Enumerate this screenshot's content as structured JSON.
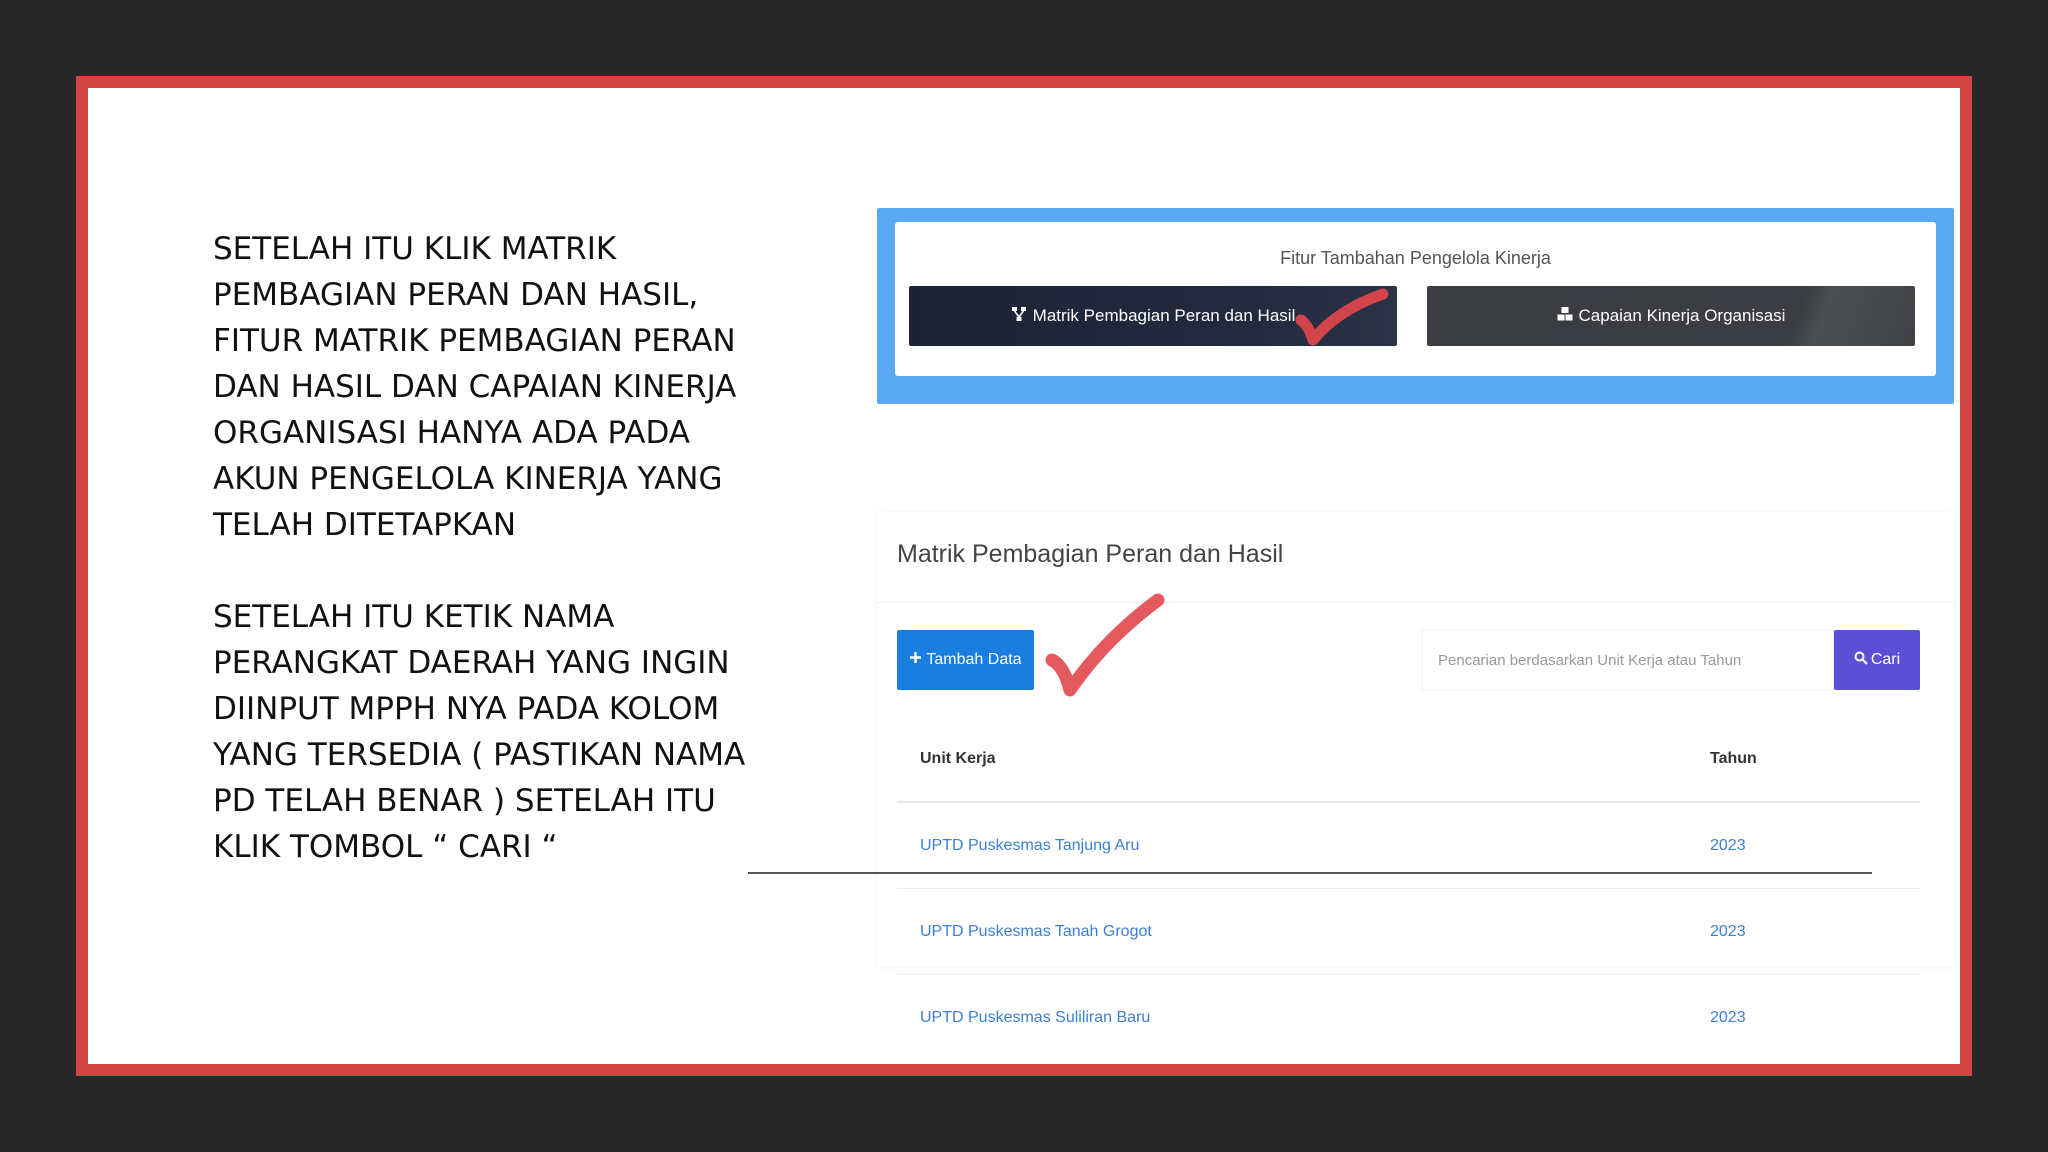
{
  "instructions": {
    "paragraph_1": "SETELAH ITU KLIK MATRIK PEMBAGIAN PERAN DAN HASIL, FITUR MATRIK PEMBAGIAN PERAN DAN HASIL DAN CAPAIAN KINERJA ORGANISASI HANYA ADA PADA AKUN PENGELOLA KINERJA YANG TELAH DITETAPKAN",
    "paragraph_2": "SETELAH ITU KETIK NAMA PERANGKAT DAERAH YANG INGIN DIINPUT MPPH NYA PADA KOLOM YANG TERSEDIA ( PASTIKAN NAMA PD TELAH BENAR ) SETELAH ITU KLIK TOMBOL “ CARI “"
  },
  "feature_panel": {
    "title": "Fitur Tambahan Pengelola Kinerja",
    "matrix_button": "Matrik Pembagian Peran dan Hasil",
    "capaian_button": "Capaian Kinerja Organisasi",
    "matrix_icon": "sitemap-icon",
    "capaian_icon": "cubes-icon"
  },
  "table_card": {
    "heading": "Matrik Pembagian Peran dan Hasil",
    "add_button": "Tambah Data",
    "search_placeholder": "Pencarian berdasarkan Unit Kerja atau Tahun",
    "search_button": "Cari",
    "columns": [
      "Unit Kerja",
      "Tahun"
    ],
    "rows": [
      {
        "unit": "UPTD Puskesmas Tanjung Aru",
        "year": "2023"
      },
      {
        "unit": "UPTD Puskesmas Tanah Grogot",
        "year": "2023"
      },
      {
        "unit": "UPTD Puskesmas Suliliran Baru",
        "year": "2023"
      }
    ]
  },
  "colors": {
    "frame": "#d24644",
    "feature_card": "#5aa9f2",
    "add_button": "#1a7ee0",
    "search_button": "#5b4fd6",
    "link": "#3b7fd6",
    "check_mark": "#e0474c"
  }
}
